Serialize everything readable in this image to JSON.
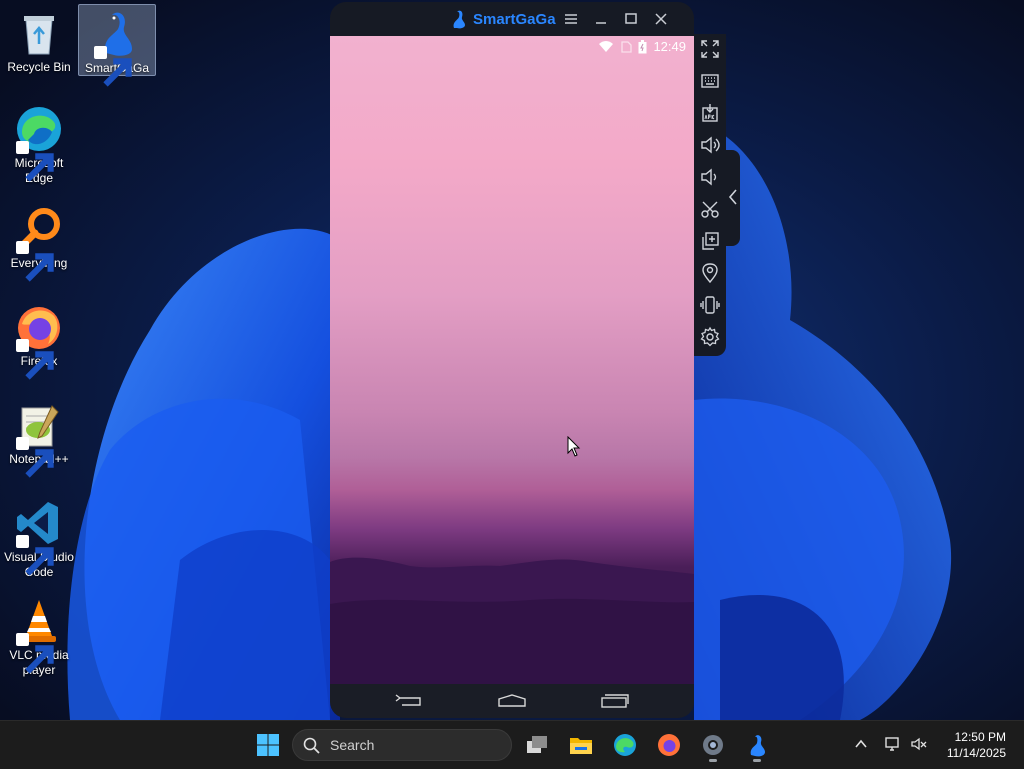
{
  "desktop": {
    "icons": [
      {
        "label": "Recycle Bin"
      },
      {
        "label": "SmartGaGa"
      },
      {
        "label": "Microsoft Edge"
      },
      {
        "label": "Everything"
      },
      {
        "label": "Firefox"
      },
      {
        "label": "Notepad++"
      },
      {
        "label": "Visual Studio Code"
      },
      {
        "label": "VLC media player"
      }
    ]
  },
  "emulator": {
    "title": "SmartGaGa",
    "status_time": "12:49"
  },
  "taskbar": {
    "search_label": "Search",
    "clock_time": "12:50 PM",
    "clock_date": "11/14/2025"
  },
  "colors": {
    "accent": "#2a86ff",
    "taskbar": "#1c1c1c",
    "emulator_frame": "#161a24"
  }
}
